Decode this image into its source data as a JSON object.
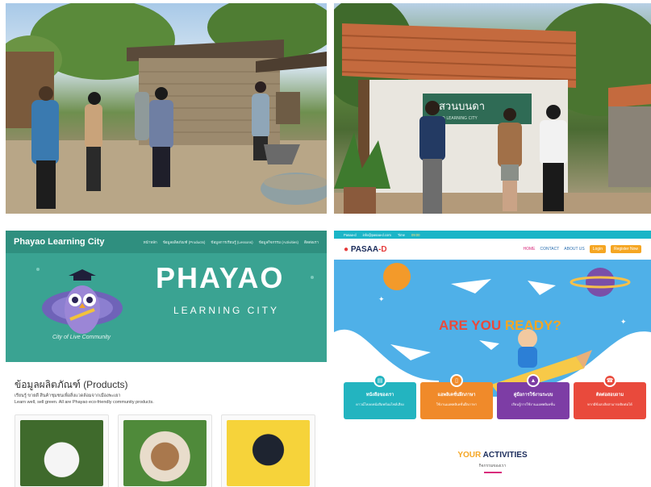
{
  "photo_top_right": {
    "sign_text": "สวนบนดา",
    "sign_subtext": "PHAYAO LEARNING CITY"
  },
  "phayao_site": {
    "logo": "Phayao Learning City",
    "nav": [
      "หน้าหลัก",
      "ข้อมูลผลิตภัณฑ์ (Products)",
      "ข้อมูลการเรียนรู้ (Lessons)",
      "ข้อมูลกิจกรรม (Activities)",
      "ติดต่อเรา"
    ],
    "hero_title": "PHAYAO",
    "hero_subtitle": "LEARNING CITY",
    "hero_caption": "City of Live Community",
    "products_title": "ข้อมูลผลิตภัณฑ์ (Products)",
    "products_desc_th": "เรียนรู้ ขายดี สินค้าชุมชนเพื่อสิ่งแวดล้อมจากเมืองพะเยา",
    "products_desc_en": "Learn well, sell green. All are Phayao eco-friendly community products.",
    "colors": {
      "primary": "#2f8f7f",
      "hero": "#3aa392"
    }
  },
  "pasaa_site": {
    "topbar": [
      "Pasaa-d",
      "info@pasaa-d.com",
      "Time",
      "09:00"
    ],
    "logo_prefix": "PASAA",
    "logo_suffix": "-D",
    "nav": [
      "HOME",
      "CONTACT",
      "ABOUT US",
      "Login",
      "Register Now"
    ],
    "hero_text_1": "ARE YOU ",
    "hero_text_2": "READY?",
    "cards": [
      {
        "title": "หนังสือของเรา",
        "subtitle": "ดาวน์โหลดหนังสือพร้อมไฟล์เสียง",
        "color": "#23b4c0",
        "icon": "book-icon"
      },
      {
        "title": "แอพลิเคชั่นฝึกภาษา",
        "subtitle": "ใช้งานแอพพลิเคชั่นฝึกภาษา",
        "color": "#f08a2a",
        "icon": "tablet-icon"
      },
      {
        "title": "คู่มือการใช้งานระบบ",
        "subtitle": "เรียนรู้การใช้งานแอพพลิเคชั่น",
        "color": "#7d3da5",
        "icon": "grad-cap-icon"
      },
      {
        "title": "ติดต่อสอบถาม",
        "subtitle": "หากมีข้อสงสัยสามารถติดต่อได้",
        "color": "#e94a3c",
        "icon": "contact-icon"
      }
    ],
    "activities_title_1": "YOUR ",
    "activities_title_2": "ACTIVITIES",
    "activities_sub": "กิจกรรมของเรา",
    "colors": {
      "sky": "#4fb0e8",
      "accent": "#f5a623",
      "pink": "#d92c7c"
    }
  }
}
